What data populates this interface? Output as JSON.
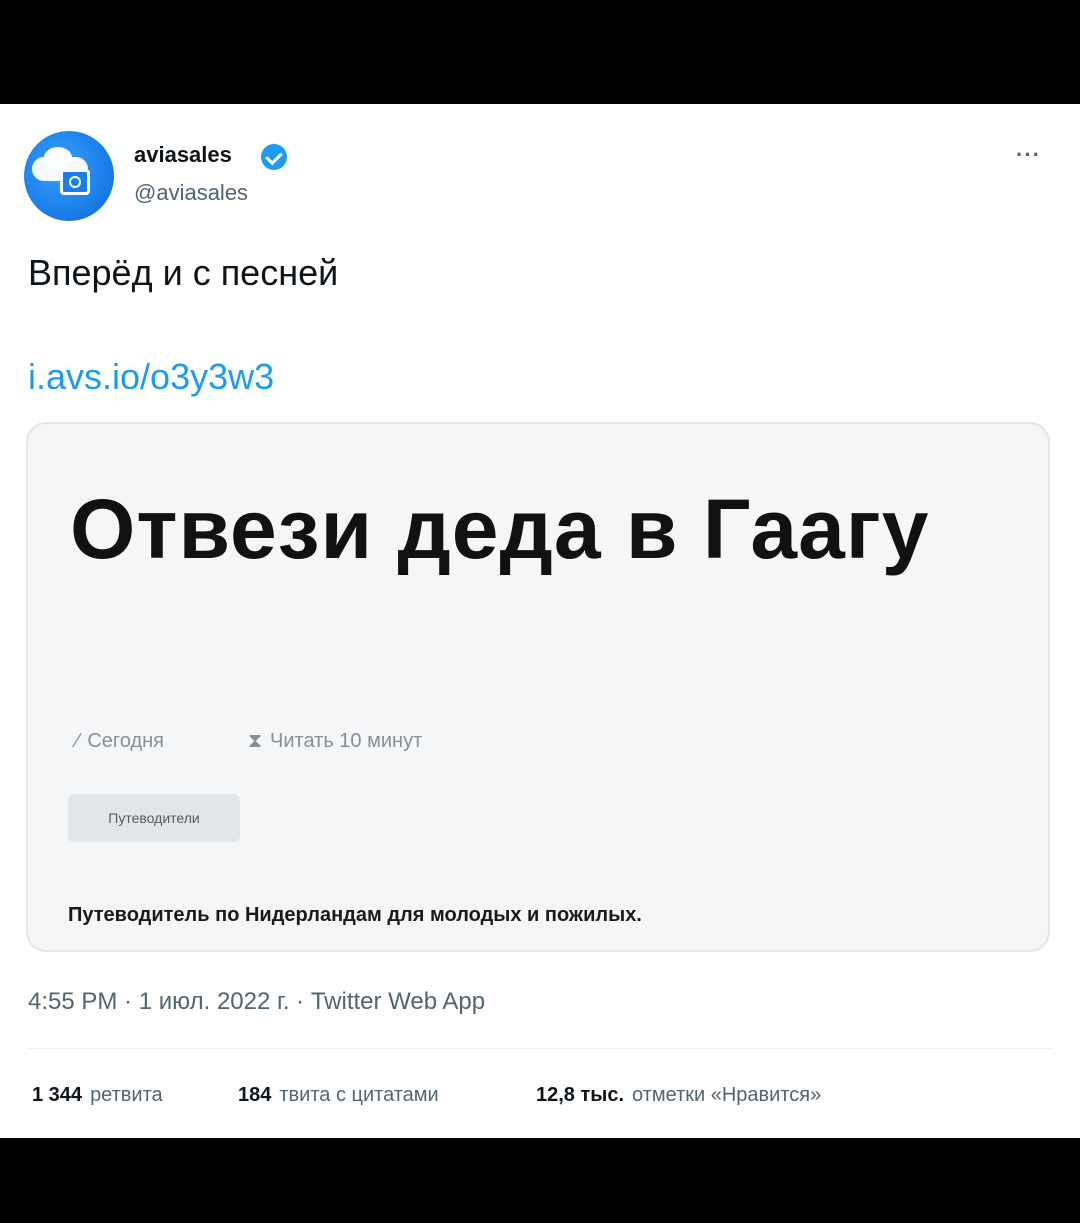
{
  "author": {
    "name": "aviasales",
    "handle": "@aviasales",
    "verified": true,
    "avatar_icon": "aviasales-logo-icon"
  },
  "menu_label": "···",
  "tweet": {
    "text": "Вперёд и с песней",
    "link": "i.avs.io/o3y3w3"
  },
  "card": {
    "title": "Отвези деда в Гаагу",
    "date_icon": "pencil-icon",
    "date": "Сегодня",
    "read_icon": "hourglass-icon",
    "read_time": "Читать 10 минут",
    "tag": "Путеводители",
    "description": "Путеводитель по Нидерландам для молодых и пожилых."
  },
  "timestamp": "4:55 PM · 1 июл. 2022 г. · Twitter Web App",
  "stats": {
    "retweets_count": "1 344",
    "retweets_label": "ретвита",
    "quotes_count": "184",
    "quotes_label": "твита с цитатами",
    "likes_count": "12,8 тыс.",
    "likes_label": "отметки «Нравится»"
  },
  "colors": {
    "link": "#1d9bf0",
    "verified": "#1d9bf0",
    "secondary_text": "#536471"
  }
}
